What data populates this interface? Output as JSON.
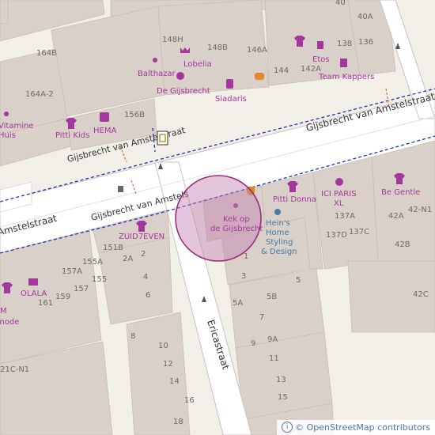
{
  "map": {
    "streets": {
      "main_top": "Gijsbrecht van Amstelstraat",
      "main_mid": "Gijsbrecht van Amstelstraat",
      "main_left": "Amstelstraat",
      "main_lower": "Gijsbrecht van Amstels",
      "side": "Ericastraat"
    },
    "marker": {
      "line1": "Kek op",
      "line2": "de Gijsbrecht"
    },
    "pois": {
      "balthazar": "Balthazar",
      "lobelia": "Lobelia",
      "de_gijsbrecht": "De Gijsbrecht",
      "siadaris": "Siadaris",
      "etos": "Etos",
      "team_kappers": "Team Kappers",
      "vitamine_line1": "Vitamine",
      "vitamine_line2": "Huis",
      "pitti_kids": "Pitti Kids",
      "hema": "HEMA",
      "zuid7even": "ZUID7EVEN",
      "pitti_donna": "Pitti Donna",
      "ici_paris_line1": "ICI PARIS",
      "ici_paris_line2": "XL",
      "be_gentle": "Be Gentle",
      "heins_line1": "Hein's",
      "heins_line2": "Home",
      "heins_line3": "Styling",
      "heins_line4": "& Design",
      "olala": "OLALA",
      "m_mode_line1": "M",
      "m_mode_line2": "mode"
    },
    "housenumbers": {
      "n40": "40",
      "n40a": "40A",
      "n148h": "148H",
      "n148b": "148B",
      "n146a": "146A",
      "n138": "138",
      "n136": "136",
      "n144": "144",
      "n142a": "142A",
      "n164b": "164B",
      "n164a2": "164A-2",
      "n156b": "156B",
      "n151b": "151B",
      "n2": "2",
      "n2a": "2A",
      "n155a": "155A",
      "n157a": "157A",
      "n155": "155",
      "n157": "157",
      "n159": "159",
      "n161": "161",
      "n4": "4",
      "n6": "6",
      "n8": "8",
      "n10": "10",
      "n12": "12",
      "n14": "14",
      "n16": "16",
      "n18": "18",
      "n1": "1",
      "n3": "3",
      "n5": "5",
      "n5a": "5A",
      "n5b": "5B",
      "n7": "7",
      "n9": "9",
      "n9a": "9A",
      "n11": "11",
      "n13": "13",
      "n15": "15",
      "n137a": "137A",
      "n137d": "137D",
      "n137c": "137C",
      "n42a": "42A",
      "n42b": "42B",
      "n42n1": "42-N1",
      "n42c": "42C",
      "n21cn1": "21C-N1"
    },
    "attribution": "© OpenStreetMap contributors",
    "colors": {
      "building": "#d9d0c9",
      "road": "#ffffff",
      "poi": "#a3379d",
      "route": "#1f2fbf",
      "marker_fill": "#c080b0",
      "marker_stroke": "#9b2a78"
    }
  }
}
